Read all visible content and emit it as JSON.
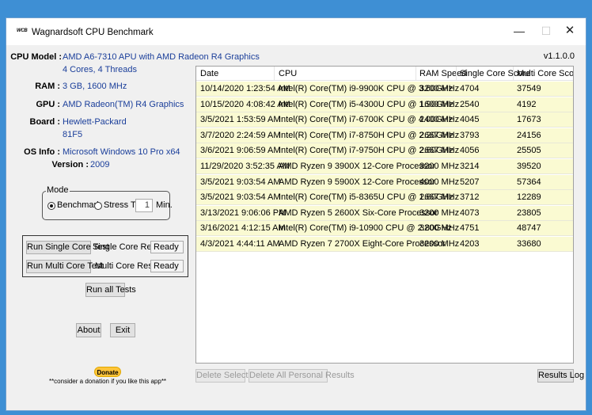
{
  "window": {
    "logo_text": "WCB",
    "title": "Wagnardsoft CPU Benchmark",
    "controls": {
      "minimize": "—",
      "maximize": "☐",
      "close": "✕"
    }
  },
  "version": "v1.1.0.0",
  "system_info": {
    "cpu_model_label": "CPU Model :",
    "cpu_model_value": "AMD A6-7310 APU with AMD Radeon R4 Graphics",
    "cpu_cores_value": "4 Cores, 4 Threads",
    "ram_label": "RAM :",
    "ram_value": "3 GB, 1600 MHz",
    "gpu_label": "GPU :",
    "gpu_value": "AMD Radeon(TM) R4 Graphics",
    "board_label": "Board :",
    "board_value": "Hewlett-Packard",
    "board_model_value": "81F5",
    "os_label": "OS Info :",
    "os_value": "Microsoft Windows 10 Pro x64",
    "os_version_label": "Version :",
    "os_version_value": "2009"
  },
  "mode": {
    "legend": "Mode",
    "benchmark_label": "Benchmark",
    "stress_label": "Stress Test",
    "stress_minutes": "1",
    "minutes_label": "Min.",
    "selected": "Benchmark"
  },
  "tests": {
    "single_button": "Run Single Core Test",
    "multi_button": "Run Multi Core Test",
    "single_result_label": "Single Core Result :",
    "single_result_value": "Ready",
    "multi_result_label": "Multi Core Result :",
    "multi_result_value": "Ready",
    "run_all_button": "Run all Tests"
  },
  "about_button": "About",
  "exit_button": "Exit",
  "donate": {
    "button": "Donate",
    "note": "**consider a donation if you like this app**"
  },
  "results": {
    "columns": [
      "Date",
      "CPU",
      "RAM Speed",
      "Single Core Score",
      "Multi Core Score"
    ],
    "rows": [
      [
        "10/14/2020 1:23:54 AM",
        "Intel(R) Core(TM) i9-9900K CPU @ 3.60GHz",
        "3200 MHz",
        "4704",
        "37549"
      ],
      [
        "10/15/2020 4:08:42 AM",
        "Intel(R) Core(TM) i5-4300U CPU @ 1.90GHz",
        "1600 MHz",
        "2540",
        "4192"
      ],
      [
        "3/5/2021 1:53:59 AM",
        "Intel(R) Core(TM) i7-6700K CPU @ 4.00GHz",
        "2400 MHz",
        "4045",
        "17673"
      ],
      [
        "3/7/2020 2:24:59 AM",
        "Intel(R) Core(TM) i7-8750H CPU @ 2.20GHz",
        "2667 MHz",
        "3793",
        "24156"
      ],
      [
        "3/6/2021 9:06:59 AM",
        "Intel(R) Core(TM) i7-9750H CPU @ 2.60GHz",
        "2667 MHz",
        "4056",
        "25505"
      ],
      [
        "11/29/2020 3:52:35 AM",
        "AMD Ryzen 9 3900X 12-Core Processor",
        "3200 MHz",
        "3214",
        "39520"
      ],
      [
        "3/5/2021 9:03:54 AM",
        "AMD Ryzen 9 5900X 12-Core Processor",
        "4000 MHz",
        "5207",
        "57364"
      ],
      [
        "3/5/2021 9:03:54 AM",
        "Intel(R) Core(TM) i5-8365U CPU @ 1.60GHz",
        "2667 MHz",
        "3712",
        "12289"
      ],
      [
        "3/13/2021 9:06:06 PM",
        "AMD Ryzen 5 2600X Six-Core Processor",
        "3200 MHz",
        "4073",
        "23805"
      ],
      [
        "3/16/2021 4:12:15 AM",
        "Intel(R) Core(TM) i9-10900 CPU @ 2.80GHz",
        "3200 MHz",
        "4751",
        "48747"
      ],
      [
        "4/3/2021 4:44:11 AM",
        "AMD Ryzen 7 2700X Eight-Core Processor",
        "3200 MHz",
        "4203",
        "33680"
      ]
    ],
    "row_color": "#fafad2"
  },
  "bottom_buttons": {
    "delete_selection": "Delete Selection",
    "delete_all": "Delete All Personal Results",
    "results_log": "Results Log"
  },
  "colors": {
    "accent_text": "#1a3e9a",
    "desktop": "#3e8fd4",
    "donate": "#ffc439"
  }
}
